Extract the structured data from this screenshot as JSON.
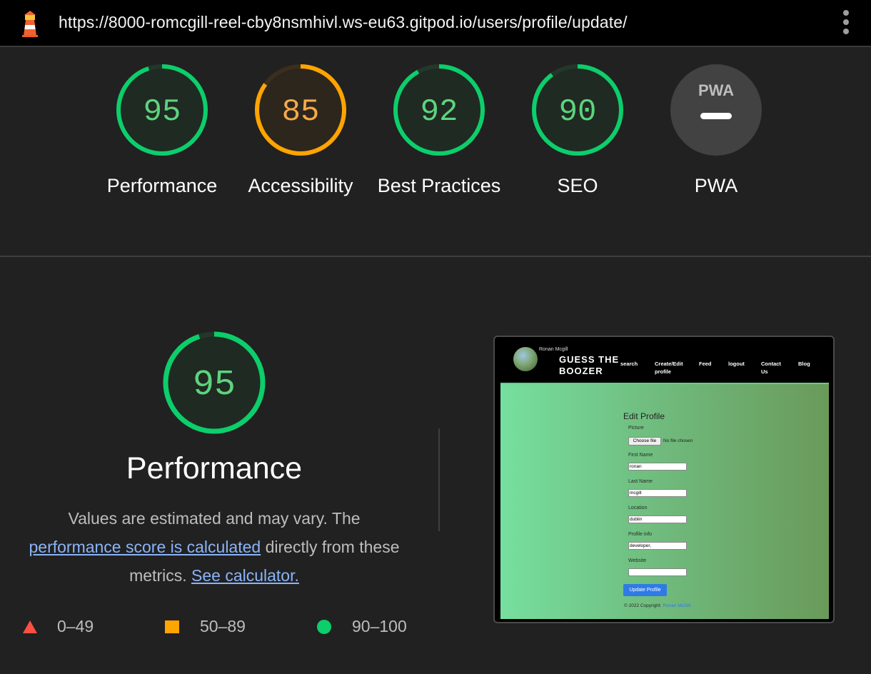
{
  "browser": {
    "url": "https://8000-romcgill-reel-cby8nsmhivl.ws-eu63.gitpod.io/users/profile/update/"
  },
  "colors": {
    "pass": "#0cce6b",
    "pass_text": "#5dd47e",
    "average": "#ffa400",
    "average_text": "#f4a94a",
    "fail": "#ff4e42",
    "link": "#8ab4f8",
    "background": "#212121"
  },
  "gauges": [
    {
      "id": "performance",
      "score": "95",
      "value": 95,
      "label": "Performance",
      "status": "pass"
    },
    {
      "id": "accessibility",
      "score": "85",
      "value": 85,
      "label": "Accessibility",
      "status": "average"
    },
    {
      "id": "best-practices",
      "score": "92",
      "value": 92,
      "label": "Best Practices",
      "status": "pass"
    },
    {
      "id": "seo",
      "score": "90",
      "value": 90,
      "label": "SEO",
      "status": "pass"
    },
    {
      "id": "pwa",
      "score": "",
      "label": "PWA",
      "status": "not-applicable",
      "badge": "PWA",
      "icon": "pwa-dash-icon"
    }
  ],
  "performance_section": {
    "score": "95",
    "value": 95,
    "title": "Performance",
    "desc_prefix": "Values are estimated and may vary. The",
    "desc_link1": "performance score is calculated",
    "desc_middle": "directly from these metrics.",
    "desc_link2": "See calculator."
  },
  "legend": [
    {
      "icon": "triangle-icon",
      "range": "0–49",
      "color": "#ff4e42"
    },
    {
      "icon": "square-icon",
      "range": "50–89",
      "color": "#ffa400"
    },
    {
      "icon": "circle-icon",
      "range": "90–100",
      "color": "#0cce6b"
    }
  ],
  "page_screenshot": {
    "username": "Ronan Mcgill",
    "brand_line1": "GUESS THE",
    "brand_line2": "BOOZER",
    "nav_links": [
      "search",
      "Create/Edit profile",
      "Feed",
      "logout",
      "Contact Us",
      "Blog"
    ],
    "form_title": "Edit Profile",
    "picture_label": "Picture",
    "choose_file": "Choose file",
    "no_file": "No file chosen",
    "fields": [
      {
        "label": "First Name",
        "value": "ronan"
      },
      {
        "label": "Last Name",
        "value": "mcgill"
      },
      {
        "label": "Location",
        "value": "dublin"
      },
      {
        "label": "Profile info",
        "value": "developer,"
      },
      {
        "label": "Website",
        "value": ""
      }
    ],
    "button": "Update Profile",
    "footer_text": "© 2022 Copyright:",
    "footer_link": "Ronan McGill"
  }
}
